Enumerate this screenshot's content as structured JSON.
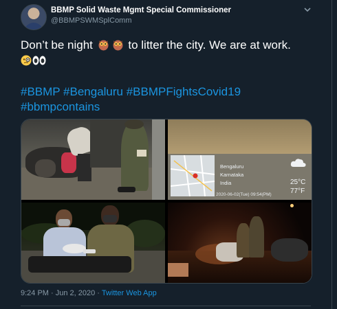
{
  "tweet": {
    "author_name": "BBMP Solid Waste Mgmt Special Commissioner",
    "author_handle": "@BBMPSWMSplComm",
    "text_part1": "Don’t be night",
    "text_part2": "to litter the city. We are at work.",
    "emojis": [
      "owl-emoji",
      "owl-emoji",
      "face-with-monocle-emoji",
      "eyes-emoji"
    ],
    "hashtags_line1": "#BBMP #Bengaluru #BBMPFightsCovid19",
    "hashtags_line2": "#bbmpcontains",
    "timestamp": "9:24 PM · Jun 2, 2020 ·",
    "source": "Twitter Web App"
  },
  "media": {
    "photo_count": 4,
    "weather_overlay": {
      "city": "Bengaluru",
      "state": "Karnataka",
      "country": "India",
      "temp_c": "25°C",
      "temp_f": "77°F",
      "datetime": "2020-06-02(Tue) 09:54(PM)"
    }
  },
  "colors": {
    "background": "#15202b",
    "link": "#1b95e0",
    "muted": "#8899a6",
    "divider": "#38444d"
  }
}
